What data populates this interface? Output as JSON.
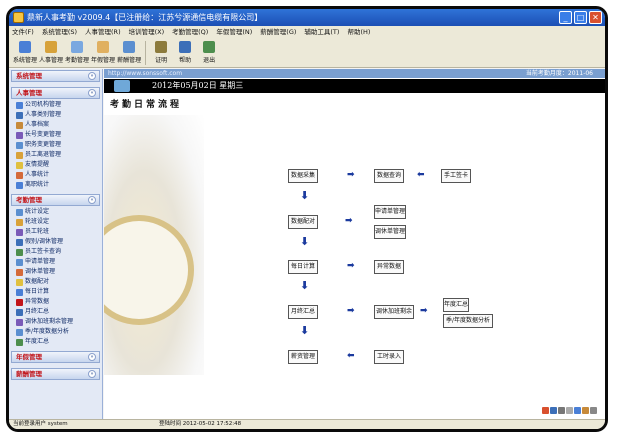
{
  "window": {
    "title": "鼎新人事考勤 v2009.4【已注册给：江苏兮源通信电缆有限公司】",
    "min_label": "_",
    "max_label": "□",
    "close_label": "✕"
  },
  "menubar": [
    "文件(F)",
    "系统管理(S)",
    "人事管理(R)",
    "培训管理(X)",
    "考勤管理(Q)",
    "年假管理(N)",
    "薪酬管理(G)",
    "辅助工具(T)",
    "帮助(H)"
  ],
  "toolbar": [
    "系统管理",
    "人事管理",
    "考勤管理",
    "年假管理",
    "薪酬管理",
    "证明",
    "帮助",
    "退出"
  ],
  "sidebar": {
    "sections": [
      {
        "title": "系统管理",
        "items": []
      },
      {
        "title": "人事管理",
        "items": [
          "公司机构管理",
          "人事类别管理",
          "人事档案",
          "长号变更管理",
          "职务变更管理",
          "员工离退管理",
          "友情提醒",
          "人事统计",
          "离职统计"
        ]
      },
      {
        "title": "考勤管理",
        "items": [
          "统计设定",
          "轮班设定",
          "员工轮班",
          "假别/调休管理",
          "员工签卡查询",
          "申请单管理",
          "调休单管理",
          "数据配对",
          "每日计算",
          "异常数据",
          "月终汇总",
          "调休加班剩余管理",
          "季/年度数据分析",
          "年度汇总"
        ]
      },
      {
        "title": "年假管理",
        "items": []
      },
      {
        "title": "薪酬管理",
        "items": []
      }
    ]
  },
  "main": {
    "url": "http://www.sonssoft.com",
    "current_period": "当前考勤月度：2011-06",
    "date": "2012年05月02日 星期三",
    "page_title": "考勤日常流程"
  },
  "flow": {
    "collect": "数据采集",
    "query": "数据查询",
    "manual": "手工签卡",
    "pair": "数据配对",
    "apply": "申请单管理",
    "transfer": "调休单管理",
    "daily": "每日计算",
    "abnormal": "异常数据",
    "monthly": "月终汇总",
    "leftover": "调休加班剩余",
    "yearly": "年度汇总",
    "analysis": "季/年度数据分析",
    "payroll": "薪资管理",
    "hours": "工时录入"
  },
  "status": {
    "user": "当前登录用户  system",
    "time": "登陆时间  2012-05-02 17:52:48"
  },
  "colors": {
    "title_blue": "#1c4fb4",
    "arrow_blue": "#1b3a9e",
    "section_red": "#c2151a"
  }
}
